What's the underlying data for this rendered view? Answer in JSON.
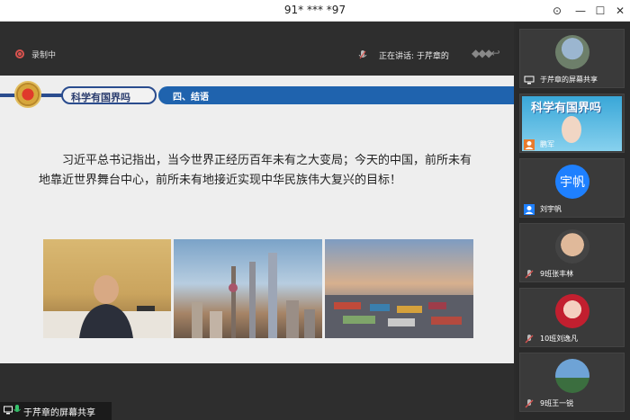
{
  "window": {
    "title": "91* *** *97"
  },
  "topbar": {
    "recording_label": "录制中",
    "speaking_label": "正在讲话: 于芹章的"
  },
  "slide": {
    "section_title": "科学有国界吗",
    "chapter": "四、结语",
    "body": "习近平总书记指出，当今世界正经历百年未有之大变局；今天的中国，前所未有地靠近世界舞台中心，前所未有地接近实现中华民族伟大复兴的目标！"
  },
  "share_bar": {
    "label": "于芹章的屏幕共享"
  },
  "participants": [
    {
      "name": "于芹章的屏幕共享",
      "kind": "screen-share"
    },
    {
      "name": "鹏军",
      "kind": "video",
      "thumb_title": "科学有国界吗"
    },
    {
      "name": "刘宇帆",
      "kind": "text-avatar",
      "avatar_text": "宇帆"
    },
    {
      "name": "9班张丰林",
      "kind": "photo"
    },
    {
      "name": "10班刘逸凡",
      "kind": "photo"
    },
    {
      "name": "9班王一锐",
      "kind": "photo"
    }
  ],
  "colors": {
    "accent": "#1f63ae",
    "record": "#d9534f",
    "avatar_blue": "#1e80ff"
  }
}
